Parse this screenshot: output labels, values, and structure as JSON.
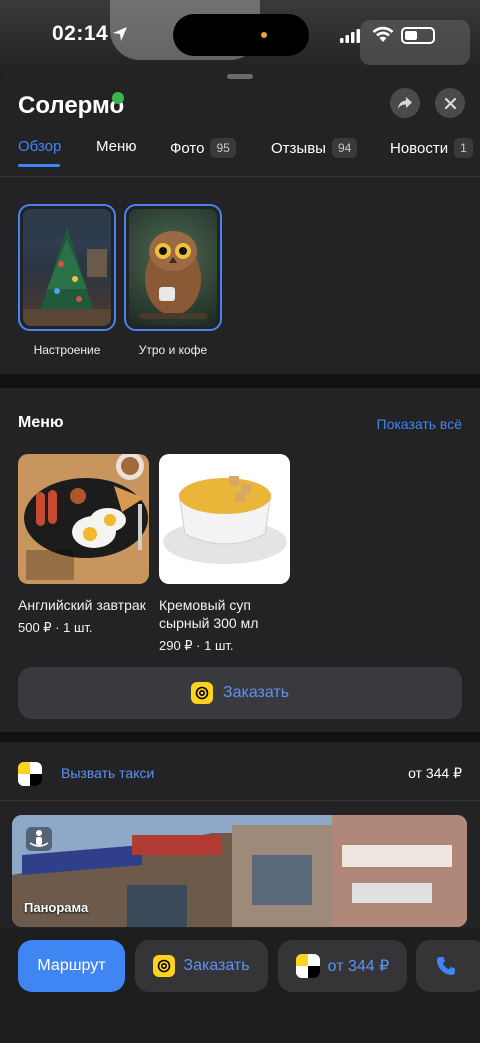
{
  "status_bar": {
    "time": "02:14"
  },
  "header": {
    "title": "Солермо"
  },
  "tabs": [
    {
      "label": "Обзор",
      "count": ""
    },
    {
      "label": "Меню",
      "count": ""
    },
    {
      "label": "Фото",
      "count": "95"
    },
    {
      "label": "Отзывы",
      "count": "94"
    },
    {
      "label": "Новости",
      "count": "1"
    }
  ],
  "stories": [
    {
      "caption": "Настроение"
    },
    {
      "caption": "Утро и кофе"
    }
  ],
  "menu": {
    "title": "Меню",
    "show_all": "Показать всё",
    "dishes": [
      {
        "name": "Английский завтрак",
        "price": "500 ₽ · 1 шт."
      },
      {
        "name": "Кремовый суп сырный 300 мл",
        "price": "290 ₽ · 1 шт."
      }
    ],
    "order_label": "Заказать"
  },
  "taxi": {
    "label": "Вызвать такси",
    "price": "от 344 ₽"
  },
  "panorama": {
    "label": "Панорама"
  },
  "bottom_bar": {
    "route": "Маршрут",
    "order": "Заказать",
    "taxi_price": "от 344 ₽"
  },
  "colors": {
    "accent": "#3f86f4",
    "yandex_yellow": "#ffd21f",
    "background": "#232325"
  }
}
